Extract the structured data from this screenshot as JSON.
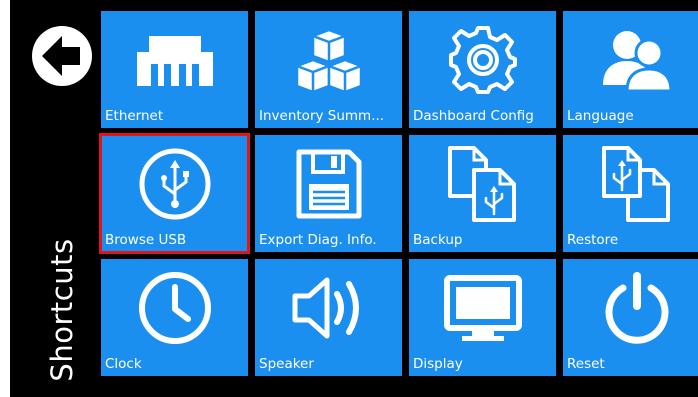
{
  "sidebar": {
    "title": "Shortcuts"
  },
  "accent": "#1b8ff0",
  "selected_color": "#e0161c",
  "tiles": [
    {
      "label": "Ethernet",
      "icon": "ethernet-icon"
    },
    {
      "label": "Inventory Summ...",
      "icon": "cubes-icon"
    },
    {
      "label": "Dashboard Config",
      "icon": "gear-icon"
    },
    {
      "label": "Language",
      "icon": "users-icon"
    },
    {
      "label": "Browse USB",
      "icon": "usb-icon",
      "selected": true
    },
    {
      "label": "Export Diag. Info.",
      "icon": "floppy-disk-icon"
    },
    {
      "label": "Backup",
      "icon": "backup-icon"
    },
    {
      "label": "Restore",
      "icon": "restore-icon"
    },
    {
      "label": "Clock",
      "icon": "clock-icon"
    },
    {
      "label": "Speaker",
      "icon": "speaker-icon"
    },
    {
      "label": "Display",
      "icon": "monitor-icon"
    },
    {
      "label": "Reset",
      "icon": "power-icon"
    }
  ]
}
